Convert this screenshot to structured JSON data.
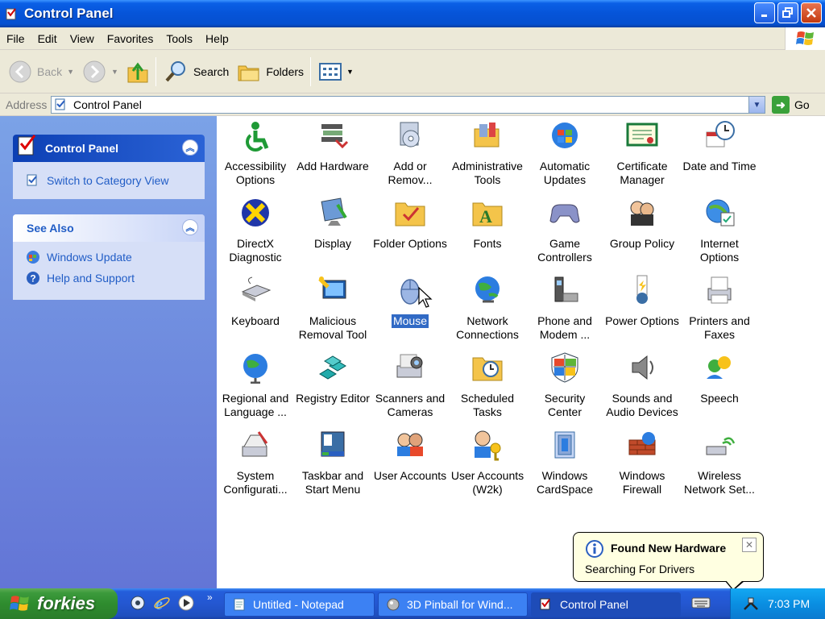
{
  "window": {
    "title": "Control Panel"
  },
  "menubar": {
    "items": [
      "File",
      "Edit",
      "View",
      "Favorites",
      "Tools",
      "Help"
    ]
  },
  "toolbar": {
    "back_label": "Back",
    "search_label": "Search",
    "folders_label": "Folders"
  },
  "address": {
    "label": "Address",
    "value": "Control Panel",
    "go_label": "Go"
  },
  "leftpane": {
    "panel1": {
      "title": "Control Panel",
      "link": "Switch to Category View"
    },
    "panel2": {
      "title": "See Also",
      "links": [
        "Windows Update",
        "Help and Support"
      ]
    }
  },
  "items": [
    {
      "label": "Accessibility Options",
      "icon": "accessibility-icon"
    },
    {
      "label": "Add Hardware",
      "icon": "add-hardware-icon"
    },
    {
      "label": "Add or Remov...",
      "icon": "add-remove-programs-icon"
    },
    {
      "label": "Administrative Tools",
      "icon": "administrative-tools-icon"
    },
    {
      "label": "Automatic Updates",
      "icon": "automatic-updates-icon"
    },
    {
      "label": "Certificate Manager",
      "icon": "certificate-icon"
    },
    {
      "label": "Date and Time",
      "icon": "date-time-icon"
    },
    {
      "label": "DirectX Diagnostic",
      "icon": "directx-icon"
    },
    {
      "label": "Display",
      "icon": "display-icon"
    },
    {
      "label": "Folder Options",
      "icon": "folder-options-icon"
    },
    {
      "label": "Fonts",
      "icon": "fonts-icon"
    },
    {
      "label": "Game Controllers",
      "icon": "game-controller-icon"
    },
    {
      "label": "Group Policy",
      "icon": "group-policy-icon"
    },
    {
      "label": "Internet Options",
      "icon": "internet-options-icon"
    },
    {
      "label": "Keyboard",
      "icon": "keyboard-icon"
    },
    {
      "label": "Malicious Removal Tool",
      "icon": "malicious-removal-icon"
    },
    {
      "label": "Mouse",
      "icon": "mouse-icon"
    },
    {
      "label": "Network Connections",
      "icon": "network-icon"
    },
    {
      "label": "Phone and Modem ...",
      "icon": "phone-modem-icon"
    },
    {
      "label": "Power Options",
      "icon": "power-icon"
    },
    {
      "label": "Printers and Faxes",
      "icon": "printer-icon"
    },
    {
      "label": "Regional and Language ...",
      "icon": "regional-icon"
    },
    {
      "label": "Registry Editor",
      "icon": "registry-icon"
    },
    {
      "label": "Scanners and Cameras",
      "icon": "scanner-camera-icon"
    },
    {
      "label": "Scheduled Tasks",
      "icon": "scheduled-tasks-icon"
    },
    {
      "label": "Security Center",
      "icon": "security-shield-icon"
    },
    {
      "label": "Sounds and Audio Devices",
      "icon": "speaker-icon"
    },
    {
      "label": "Speech",
      "icon": "speech-icon"
    },
    {
      "label": "System Configurati...",
      "icon": "system-config-icon"
    },
    {
      "label": "Taskbar and Start Menu",
      "icon": "taskbar-icon"
    },
    {
      "label": "User Accounts",
      "icon": "user-accounts-icon"
    },
    {
      "label": "User Accounts (W2k)",
      "icon": "user-accounts-key-icon"
    },
    {
      "label": "Windows CardSpace",
      "icon": "cardspace-icon"
    },
    {
      "label": "Windows Firewall",
      "icon": "firewall-icon"
    },
    {
      "label": "Wireless Network Set...",
      "icon": "wireless-icon"
    }
  ],
  "selected_item": "Mouse",
  "balloon": {
    "title": "Found New Hardware",
    "message": "Searching For Drivers"
  },
  "taskbar": {
    "start_label": "forkies",
    "tasks": [
      "Untitled - Notepad",
      "3D Pinball for Wind...",
      "Control Panel"
    ],
    "clock": "7:03 PM"
  }
}
